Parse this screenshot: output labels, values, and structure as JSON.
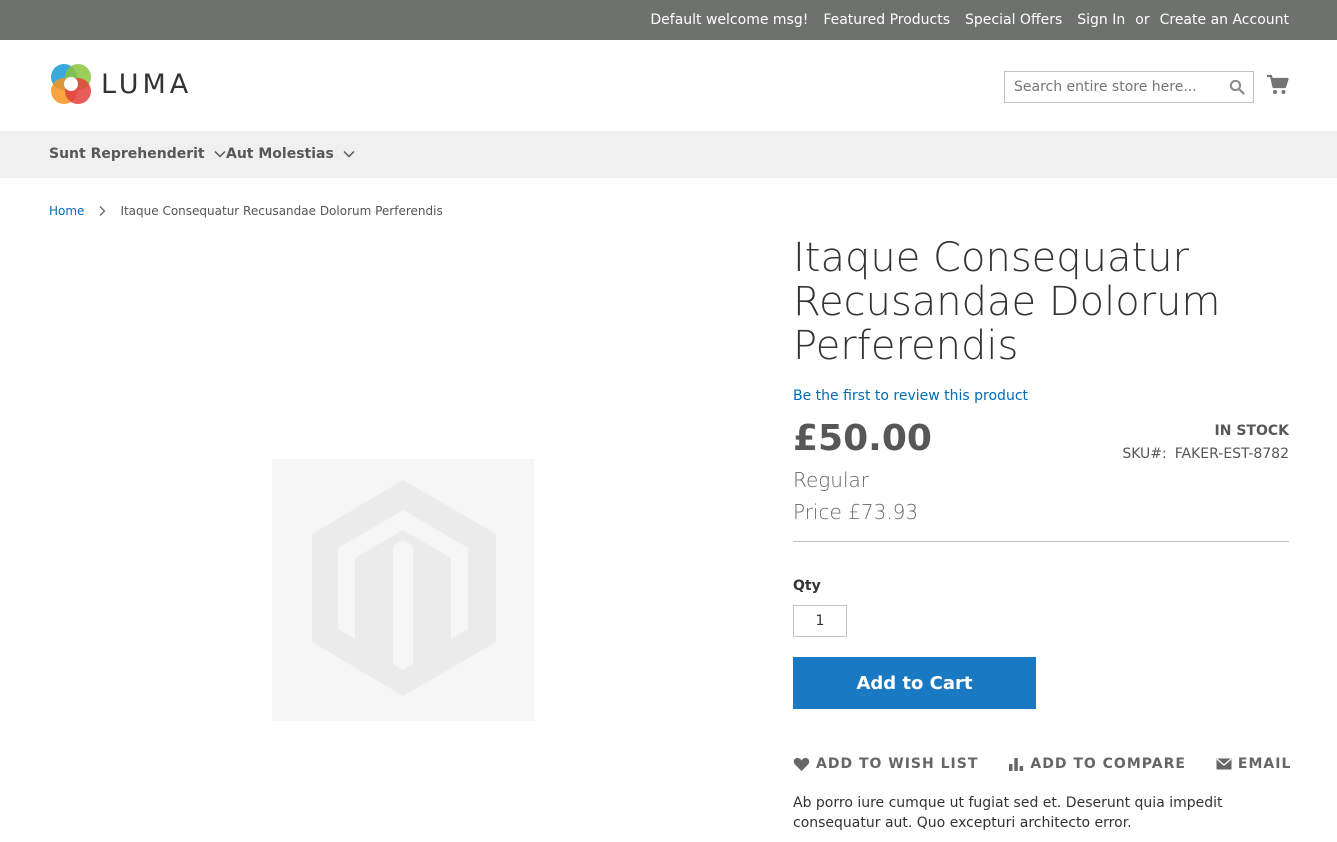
{
  "topbar": {
    "welcome": "Default welcome msg!",
    "links": [
      "Featured Products",
      "Special Offers",
      "Sign In"
    ],
    "or": "or",
    "create_account": "Create an Account"
  },
  "header": {
    "logo_text": "LUMA",
    "search_placeholder": "Search entire store here...",
    "cart_icon": "cart-icon"
  },
  "nav": {
    "items": [
      "Sunt Reprehenderit",
      "Aut Molestias"
    ]
  },
  "breadcrumb": {
    "home": "Home",
    "current": "Itaque Consequatur Recusandae Dolorum Perferendis"
  },
  "product": {
    "title": "Itaque Consequatur Recusandae Dolorum Perferendis",
    "review_link": "Be the first to review this product",
    "price": "£50.00",
    "regular_label": "Regular",
    "regular_price": "Price £73.93",
    "stock": "In stock",
    "sku_label": "SKU#:",
    "sku": "FAKER-EST-8782",
    "qty_label": "Qty",
    "qty_value": "1",
    "add_to_cart": "Add to Cart",
    "actions": {
      "wishlist": "Add to Wish List",
      "compare": "Add to Compare",
      "email": "Email"
    },
    "description": "Ab porro iure cumque ut fugiat sed et. Deserunt quia impedit consequatur aut. Quo excepturi architecto error."
  },
  "colors": {
    "topbar": "#6e716e",
    "accent": "#1979c3",
    "link": "#006bb4",
    "nav_bg": "#f0f0f0"
  }
}
